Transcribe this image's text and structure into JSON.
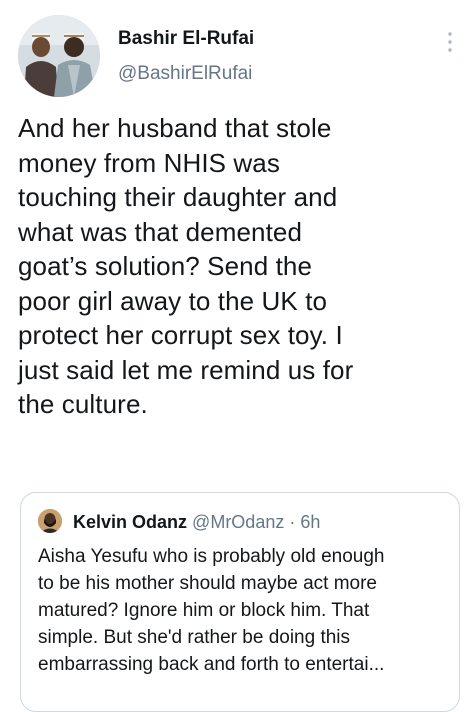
{
  "tweet": {
    "author": {
      "display_name": "Bashir El-Rufai",
      "handle": "@BashirElRufai",
      "avatar_icon": "user-avatar-photo"
    },
    "menu_icon": "more-vertical-icon",
    "body_lines": [
      "And her husband that stole",
      "money from NHIS was",
      "touching their daughter and",
      "what was that demented",
      "goat’s solution? Send the",
      "poor girl away to the UK to",
      "protect her corrupt sex toy. I",
      "just said let me remind us for",
      "the culture."
    ]
  },
  "quoted_tweet": {
    "author": {
      "display_name": "Kelvin Odanz",
      "handle": "@MrOdanz",
      "separator": "·",
      "time": "6h",
      "avatar_icon": "user-avatar-photo"
    },
    "text_lines": [
      "Aisha Yesufu who is probably old enough",
      "to be his mother should maybe act more",
      "matured? Ignore him or block him. That",
      "simple. But she'd rather be doing this",
      "embarrassing back and forth to entertai..."
    ]
  },
  "colors": {
    "text_primary": "#14171a",
    "text_secondary": "#657786",
    "border": "#cfd9de"
  }
}
